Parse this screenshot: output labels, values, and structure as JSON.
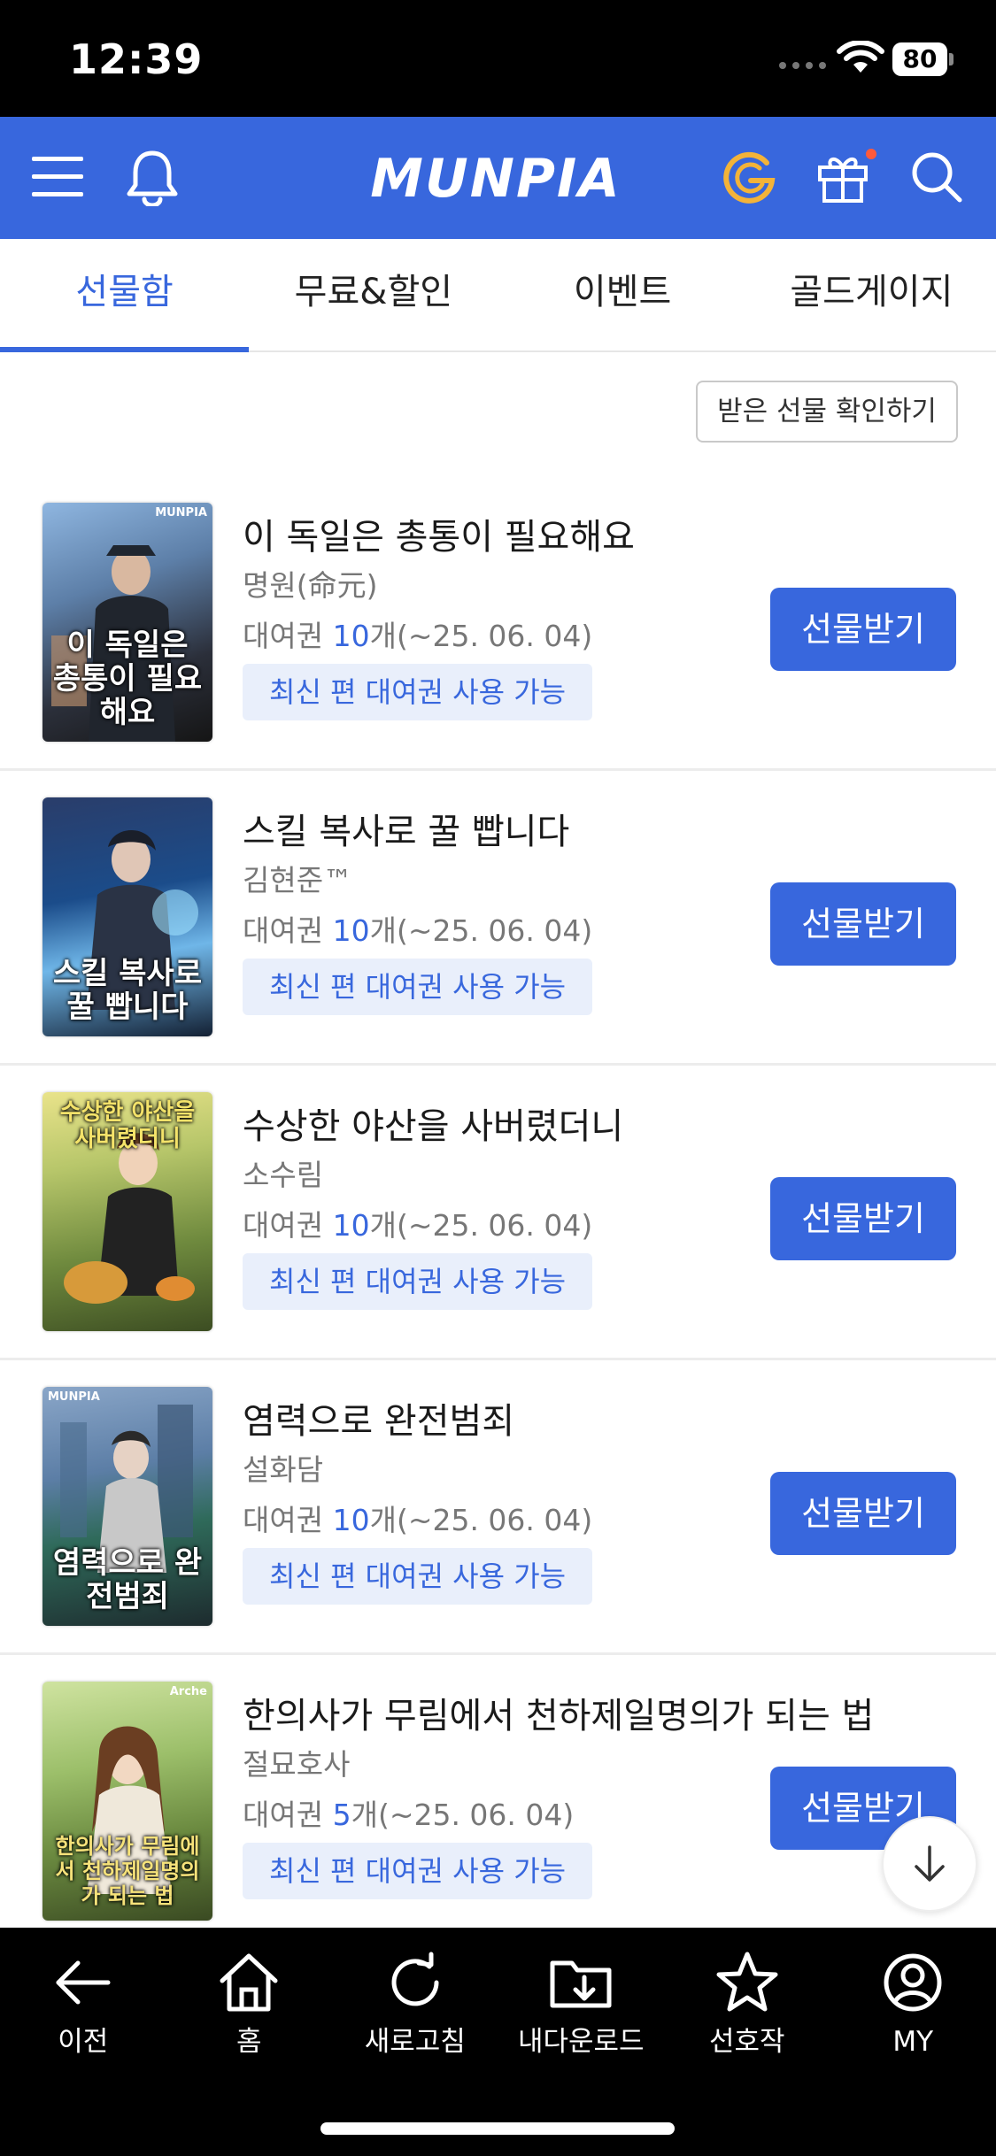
{
  "status_bar": {
    "time": "12:39",
    "battery": "80"
  },
  "header": {
    "logo": "MUNPIA",
    "icons": [
      "menu-icon",
      "bell-icon",
      "gold-coin-icon",
      "gift-icon",
      "search-icon"
    ],
    "brand_color": "#3867dd"
  },
  "tabs": [
    {
      "label": "선물함",
      "active": true
    },
    {
      "label": "무료&할인"
    },
    {
      "label": "이벤트"
    },
    {
      "label": "골드게이지"
    }
  ],
  "check_received_label": "받은 선물 확인하기",
  "items": [
    {
      "title": "이 독일은 총통이 필요해요",
      "author": "명원(命元)",
      "ticket_prefix": "대여권 ",
      "ticket_count": "10",
      "ticket_suffix": "개(~25. 06. 04)",
      "badge": "최신 편 대여권 사용 가능",
      "button": "선물받기",
      "cover_text": "이 독일은 총통이 필요해요",
      "cover_brand": "MUNPIA"
    },
    {
      "title": "스킬 복사로 꿀 빱니다",
      "author": "김현준™",
      "ticket_prefix": "대여권 ",
      "ticket_count": "10",
      "ticket_suffix": "개(~25. 06. 04)",
      "badge": "최신 편 대여권 사용 가능",
      "button": "선물받기",
      "cover_text": "스킬 복사로 꿀 빱니다",
      "cover_brand": ""
    },
    {
      "title": "수상한 야산을 사버렸더니",
      "author": "소수림",
      "ticket_prefix": "대여권 ",
      "ticket_count": "10",
      "ticket_suffix": "개(~25. 06. 04)",
      "badge": "최신 편 대여권 사용 가능",
      "button": "선물받기",
      "cover_text": "수상한 야산을 사버렸더니",
      "cover_brand": ""
    },
    {
      "title": "염력으로 완전범죄",
      "author": "설화담",
      "ticket_prefix": "대여권 ",
      "ticket_count": "10",
      "ticket_suffix": "개(~25. 06. 04)",
      "badge": "최신 편 대여권 사용 가능",
      "button": "선물받기",
      "cover_text": "염력으로 완전범죄",
      "cover_brand": "MUNPIA"
    },
    {
      "title": "한의사가 무림에서 천하제일명의가 되는 법",
      "author": "절묘호사",
      "ticket_prefix": "대여권 ",
      "ticket_count": "5",
      "ticket_suffix": "개(~25. 06. 04)",
      "badge": "최신 편 대여권 사용 가능",
      "button": "선물받기",
      "cover_text": "한의사가 무림에서 천하제일명의가 되는 법",
      "cover_brand": "Arche"
    }
  ],
  "bottom_nav": [
    {
      "label": "이전",
      "icon": "back-arrow-icon"
    },
    {
      "label": "홈",
      "icon": "home-icon"
    },
    {
      "label": "새로고침",
      "icon": "refresh-icon"
    },
    {
      "label": "내다운로드",
      "icon": "download-folder-icon"
    },
    {
      "label": "선호작",
      "icon": "star-icon"
    },
    {
      "label": "MY",
      "icon": "user-icon"
    }
  ]
}
